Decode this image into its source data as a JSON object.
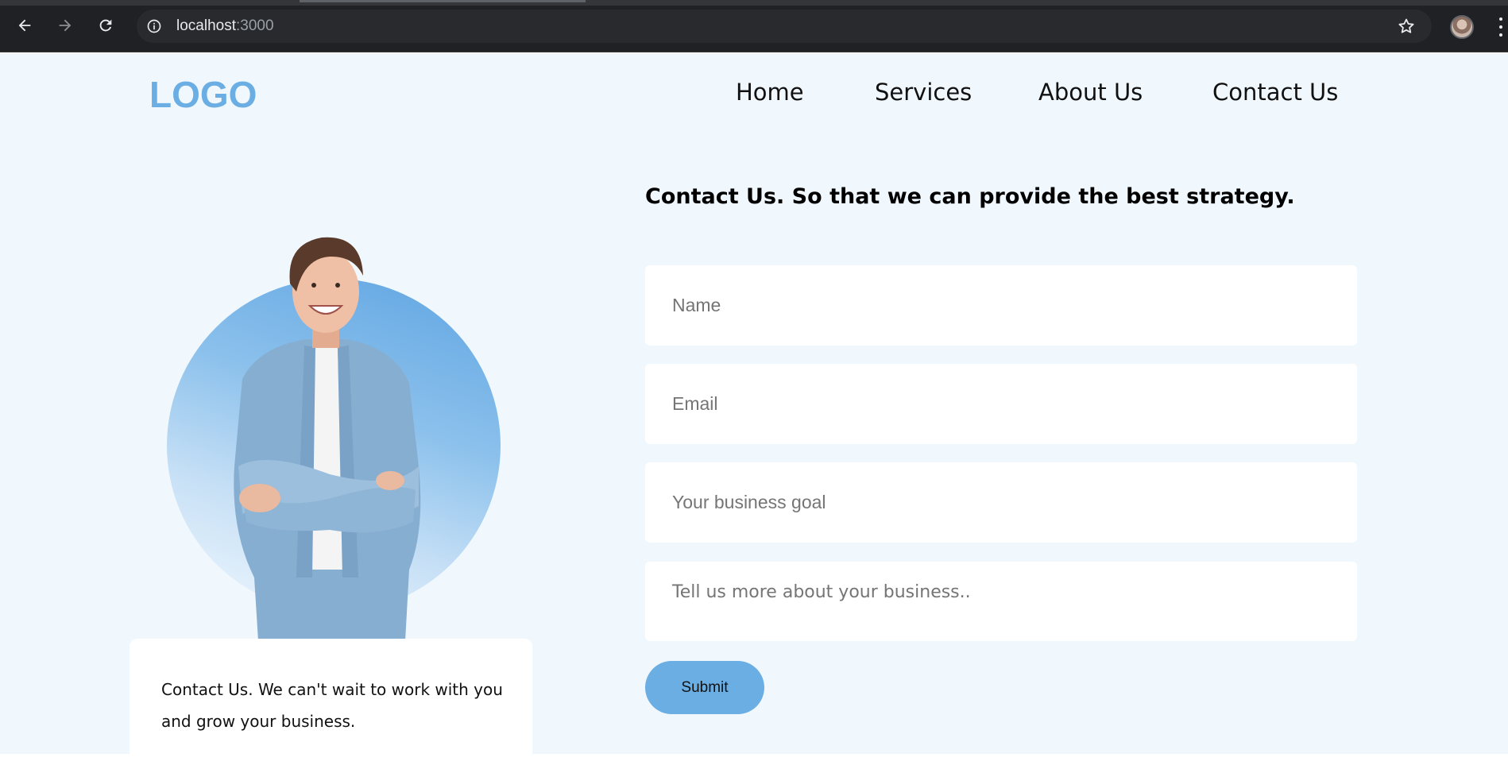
{
  "browser": {
    "url_host": "localhost",
    "url_port": ":3000",
    "icons": [
      "back-icon",
      "forward-icon",
      "reload-icon",
      "info-icon",
      "star-icon",
      "profile-avatar",
      "menu-icon"
    ]
  },
  "header": {
    "logo": "LOGO",
    "nav": [
      "Home",
      "Services",
      "About Us",
      "Contact Us"
    ]
  },
  "hero": {
    "caption": "Contact Us. We can't wait to work with you and grow your business."
  },
  "form": {
    "title": "Contact Us. So that we can provide the best strategy.",
    "name_placeholder": "Name",
    "email_placeholder": "Email",
    "goal_placeholder": "Your business goal",
    "more_placeholder": "Tell us more about your business..",
    "submit_label": "Submit"
  },
  "colors": {
    "accent": "#6aaee4",
    "page_background": "#f0f8fe",
    "chrome_background": "#202124"
  }
}
